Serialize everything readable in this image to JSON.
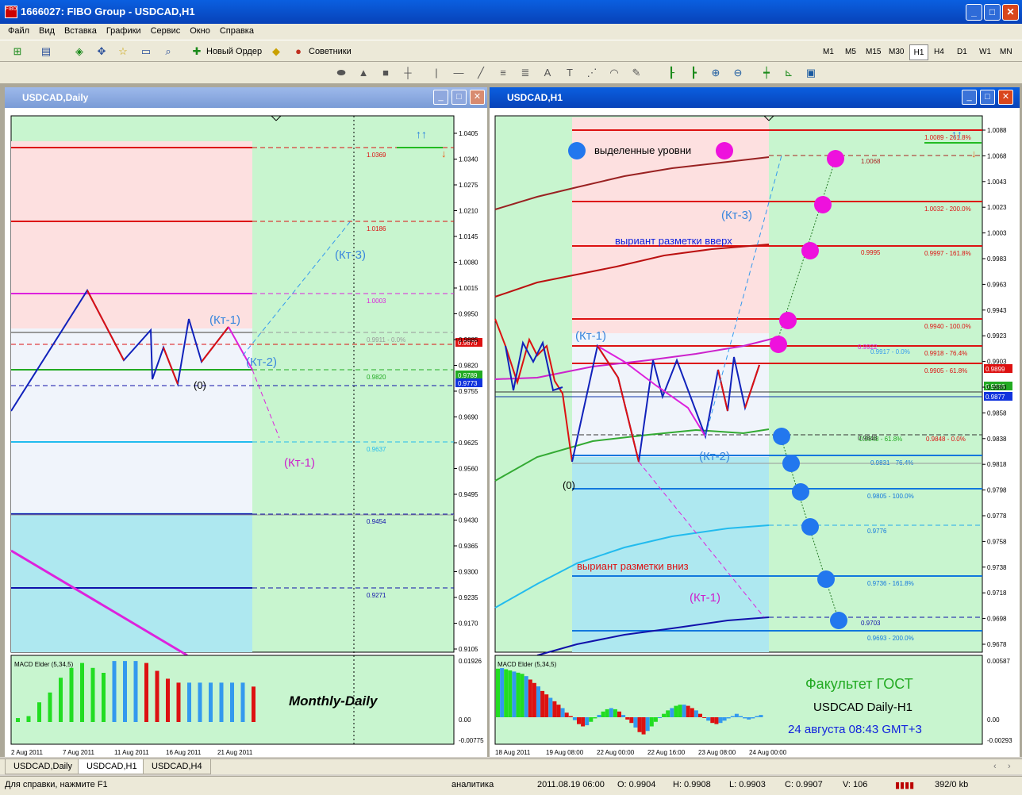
{
  "window": {
    "title": "1666027: FIBO Group - USDCAD,H1"
  },
  "menu": [
    "Файл",
    "Вид",
    "Вставка",
    "Графики",
    "Сервис",
    "Окно",
    "Справка"
  ],
  "toolbar": {
    "new_order": "Новый Ордер",
    "advisors": "Советники"
  },
  "timeframes": [
    "M1",
    "M5",
    "M15",
    "M30",
    "H1",
    "H4",
    "D1",
    "W1",
    "MN"
  ],
  "active_timeframe": "H1",
  "left_chart": {
    "title": "USDCAD,Daily",
    "price_ticks": [
      "1.0405",
      "1.0340",
      "1.0275",
      "1.0210",
      "1.0145",
      "1.0080",
      "1.0015",
      "0.9950",
      "0.9885",
      "0.9820",
      "0.9755",
      "0.9690",
      "0.9625",
      "0.9560",
      "0.9495",
      "0.9430",
      "0.9365",
      "0.9300",
      "0.9235",
      "0.9170",
      "0.9105"
    ],
    "date_ticks": [
      "2 Aug 2011",
      "7 Aug 2011",
      "11 Aug 2011",
      "16 Aug 2011",
      "21 Aug 2011"
    ],
    "level_labels": [
      "1.0369",
      "1.0186",
      "1.0003",
      "0.9911 - 0.0%",
      "0.9820",
      "0.9637",
      "0.9454",
      "0.9271"
    ],
    "price_boxes": [
      "0.9870",
      "0.9789",
      "0.9773"
    ],
    "annotations": [
      "(Кт-1)",
      "(Кт-2)",
      "(Кт-3)",
      "(Кт-1)",
      "(0)"
    ],
    "macd_label": "MACD Elder (5,34,5)",
    "macd_ticks": [
      "0.01926",
      "0.00",
      "-0.00775"
    ],
    "caption": "Monthly-Daily",
    "macd_bars": [
      0.04,
      0.06,
      0.2,
      0.3,
      0.45,
      0.55,
      0.6,
      0.55,
      0.5,
      0.62,
      0.62,
      0.62,
      0.6,
      0.52,
      0.44,
      0.4,
      0.4,
      0.4,
      0.4,
      0.4,
      0.4,
      0.4,
      0.36
    ],
    "macd_colors": [
      "#22dd22",
      "#22dd22",
      "#22dd22",
      "#22dd22",
      "#22dd22",
      "#22dd22",
      "#22dd22",
      "#22dd22",
      "#22dd22",
      "#3399ee",
      "#3399ee",
      "#3399ee",
      "#dd1111",
      "#dd1111",
      "#dd1111",
      "#dd1111",
      "#3399ee",
      "#3399ee",
      "#3399ee",
      "#3399ee",
      "#3399ee",
      "#3399ee",
      "#dd1111"
    ]
  },
  "right_chart": {
    "title": "USDCAD,H1",
    "price_ticks": [
      "1.0088",
      "1.0068",
      "1.0043",
      "1.0023",
      "1.0003",
      "0.9983",
      "0.9963",
      "0.9943",
      "0.9923",
      "0.9903",
      "0.9883",
      "0.9858",
      "0.9838",
      "0.9818",
      "0.9798",
      "0.9778",
      "0.9758",
      "0.9738",
      "0.9718",
      "0.9698",
      "0.9678"
    ],
    "date_ticks": [
      "18 Aug 2011",
      "19 Aug 08:00",
      "22 Aug 00:00",
      "22 Aug 16:00",
      "23 Aug 08:00",
      "24 Aug 00:00"
    ],
    "level_labels": [
      "1.0089 - 261.8%",
      "1.0068",
      "1.0032 - 200.0%",
      "0.9995",
      "0.9997 - 161.8%",
      "0.9940 - 100.0%",
      "0.9917 - 0.0%",
      "0.9918 - 76.4%",
      "0.9905 - 61.8%",
      "0.9848 - 61.8%",
      "0.9848 - 0.0%",
      "0.9831 - 76.4%",
      "0.9805 - 100.0%",
      "0.9776",
      "0.9736 - 161.8%",
      "0.9703",
      "0.9693 - 200.0%",
      "0.9922",
      "0.9848"
    ],
    "price_boxes": [
      "0.9899",
      "0.9886",
      "0.9877"
    ],
    "legend_text": "выделенные уровни",
    "up_text": "выриант разметки вверх",
    "down_text": "выриант разметки вниз",
    "annotations": [
      "(Кт-1)",
      "(Кт-2)",
      "(Кт-3)",
      "(Кт-1)",
      "(0)"
    ],
    "macd_label": "MACD Elder (5,34,5)",
    "macd_ticks": [
      "0.00587",
      "0.00",
      "-0.00293"
    ],
    "faculty": "Факультет ГОСТ",
    "pair": "USDCAD Daily-H1",
    "date": "24 августа 08:43 GMT+3"
  },
  "chart_tabs": [
    "USDCAD,Daily",
    "USDCAD,H1",
    "USDCAD,H4"
  ],
  "active_tab": "USDCAD,H1",
  "status": {
    "help": "Для справки, нажмите F1",
    "profile": "аналитика",
    "datetime": "2011.08.19 06:00",
    "open": "O: 0.9904",
    "high": "H: 0.9908",
    "low": "L: 0.9903",
    "close": "C: 0.9907",
    "volume": "V: 106",
    "traffic": "392/0 kb"
  },
  "colors": {
    "bull_green": "#22dd22",
    "bear_red": "#dd1111",
    "neutral_blue": "#3399ee",
    "chart_bg_green": "#c8f5cf",
    "zone_pink": "#fde0e0",
    "zone_cyan": "#aee8f0"
  }
}
